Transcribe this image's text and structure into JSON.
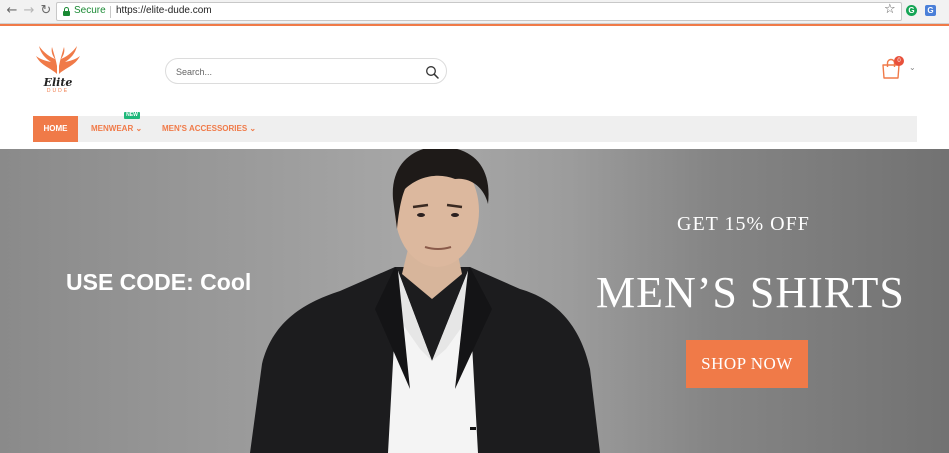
{
  "browser": {
    "secure_label": "Secure",
    "url": "https://elite-dude.com",
    "icons": [
      "back-icon",
      "forward-icon",
      "reload-icon",
      "lock-icon",
      "bookmark-star-icon",
      "grammarly-extension-icon",
      "translate-extension-icon"
    ],
    "ext1_glyph": "G",
    "ext2_glyph": "G"
  },
  "header": {
    "logo_text": "Elite",
    "logo_subtext": "DUDE",
    "search_placeholder": "Search...",
    "cart_count": "0"
  },
  "nav": {
    "home_label": "HOME",
    "items": [
      {
        "label": "MENWEAR ⌄",
        "badge": "NEW"
      },
      {
        "label": "MEN'S ACCESSORIES ⌄"
      }
    ]
  },
  "hero": {
    "code_text": "USE CODE: Cool",
    "offer_text": "GET 15% OFF",
    "title": "MEN’S SHIRTS",
    "button_label": "SHOP NOW"
  },
  "colors": {
    "accent": "#f07a48",
    "badge_green": "#1fb87a",
    "secure_green": "#1a8a34",
    "cart_badge": "#e8503a"
  }
}
